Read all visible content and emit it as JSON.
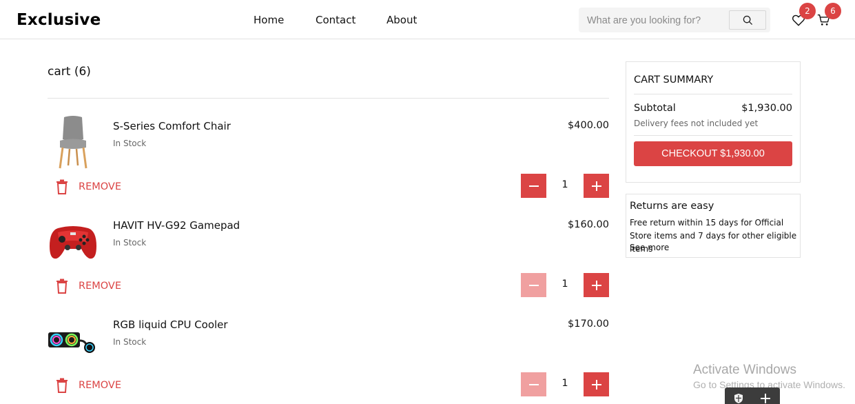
{
  "brand": "Exclusive",
  "nav": [
    "Home",
    "Contact",
    "About"
  ],
  "search": {
    "placeholder": "What are you looking for?"
  },
  "wishlist_count": "2",
  "cart_count": "6",
  "cart": {
    "title": "cart (6)",
    "remove_label": "REMOVE",
    "items": [
      {
        "name": "S-Series Comfort Chair",
        "stock": "In Stock",
        "price": "$400.00",
        "qty": "1",
        "icon": "chair"
      },
      {
        "name": "HAVIT HV-G92 Gamepad",
        "stock": "In Stock",
        "price": "$160.00",
        "qty": "1",
        "icon": "gamepad"
      },
      {
        "name": "RGB liquid CPU Cooler",
        "stock": "In Stock",
        "price": "$170.00",
        "qty": "1",
        "icon": "cpu-cooler"
      }
    ]
  },
  "summary": {
    "title": "CART SUMMARY",
    "subtotal_label": "Subtotal",
    "subtotal_value": "$1,930.00",
    "note": "Delivery fees not included yet",
    "checkout_label": "CHECKOUT $1,930.00"
  },
  "returns": {
    "title": "Returns are easy",
    "body": "Free return within 15 days for Official Store items and 7 days for other eligible items",
    "more": "See more"
  },
  "watermark": {
    "title": "Activate Windows",
    "subtitle": "Go to Settings to activate Windows."
  },
  "colors": {
    "accent": "#db4444",
    "accent_disabled": "#f0a0a0"
  }
}
